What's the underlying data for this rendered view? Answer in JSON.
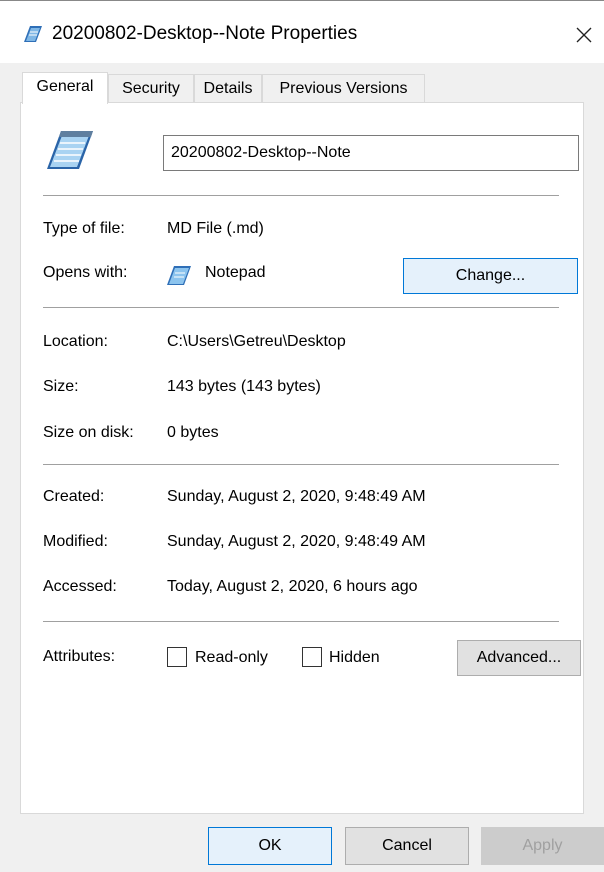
{
  "window": {
    "title": "20200802-Desktop--Note Properties",
    "title_icon": "notepad-icon",
    "close_icon": "close-icon"
  },
  "tabs": [
    {
      "label": "General",
      "active": true
    },
    {
      "label": "Security",
      "active": false
    },
    {
      "label": "Details",
      "active": false
    },
    {
      "label": "Previous Versions",
      "active": false
    }
  ],
  "general": {
    "file_icon": "notepad-file-icon",
    "file_name": "20200802-Desktop--Note",
    "type_of_file": {
      "label": "Type of file:",
      "value": "MD File (.md)"
    },
    "opens_with": {
      "label": "Opens with:",
      "value": "Notepad",
      "icon": "notepad-icon",
      "change_label": "Change..."
    },
    "location": {
      "label": "Location:",
      "value": "C:\\Users\\Getreu\\Desktop"
    },
    "size": {
      "label": "Size:",
      "value": "143 bytes (143 bytes)"
    },
    "size_on_disk": {
      "label": "Size on disk:",
      "value": "0 bytes"
    },
    "created": {
      "label": "Created:",
      "value": "Sunday, August 2, 2020, 9:48:49 AM"
    },
    "modified": {
      "label": "Modified:",
      "value": "Sunday, August 2, 2020, 9:48:49 AM"
    },
    "accessed": {
      "label": "Accessed:",
      "value": "Today, August 2, 2020, 6 hours ago"
    },
    "attributes": {
      "label": "Attributes:",
      "read_only": {
        "label": "Read-only",
        "checked": false
      },
      "hidden": {
        "label": "Hidden",
        "checked": false
      },
      "advanced_label": "Advanced..."
    }
  },
  "footer": {
    "ok_label": "OK",
    "cancel_label": "Cancel",
    "apply_label": "Apply",
    "apply_enabled": false
  },
  "colors": {
    "accent_border": "#0078d7",
    "disabled_text": "#a0a0a0"
  }
}
